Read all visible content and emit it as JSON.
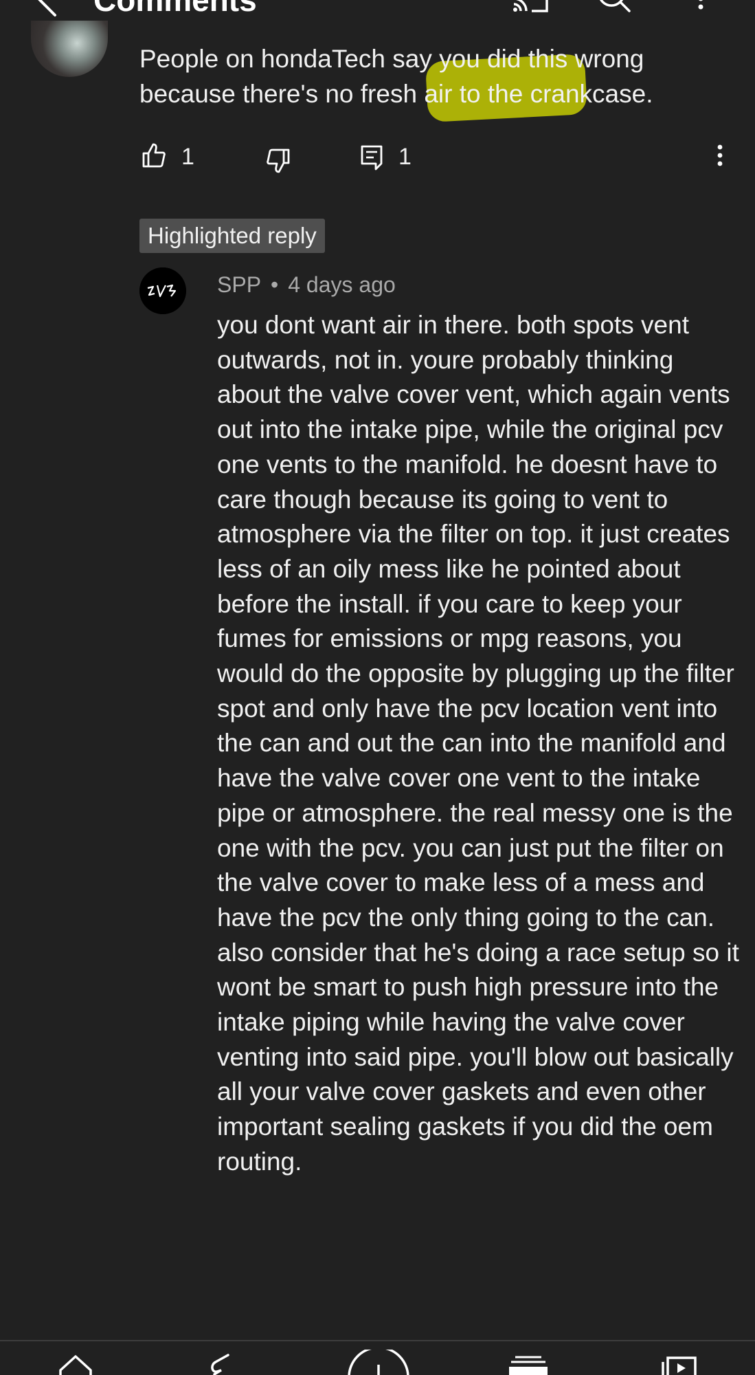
{
  "header": {
    "title": "Comments",
    "back_icon": "back-arrow-icon",
    "cast_icon": "cast-icon",
    "search_icon": "search-icon",
    "more_icon": "more-vertical-icon"
  },
  "parent_comment": {
    "text_before": "People on h",
    "text_highlight": "ondaTech say",
    "text_after": " you did this wrong because there's no fresh air to the crankcase.",
    "likes": "1",
    "replies": "1"
  },
  "highlighted_reply": {
    "badge": "Highlighted reply",
    "author": "SPP",
    "separator": "•",
    "time": "4 days ago",
    "text": "you dont want air in there. both spots vent outwards, not in. youre probably thinking about the valve cover vent, which again vents out into the intake pipe, while the original pcv one vents to the manifold. he doesnt have to care though because its going to vent to atmosphere via the filter on top. it just creates less of an oily mess like he pointed about before the install. if you care to keep your fumes for emissions or mpg reasons, you would do the opposite by plugging up the filter spot and only have the pcv location vent into the can and out the can into the manifold and have the valve cover one vent to the intake pipe or atmosphere. the real messy one is the one with the pcv. you can just put the filter on the valve cover to make less of a mess and have the pcv the only thing going to the can. also consider that he's doing a race setup so it wont be smart to push high pressure into the intake piping while having the valve cover venting into said pipe. you'll blow out basically all your valve cover gaskets and even other important sealing gaskets if you did the oem routing."
  },
  "bottom_nav": {
    "items": [
      "home-icon",
      "shorts-icon",
      "create-icon",
      "subscriptions-icon",
      "library-icon"
    ]
  },
  "colors": {
    "background": "#212121",
    "text": "#f1f1f1",
    "secondary_text": "#aaaaaa",
    "badge": "#4f4f4f",
    "highlighter": "#d4da00"
  }
}
